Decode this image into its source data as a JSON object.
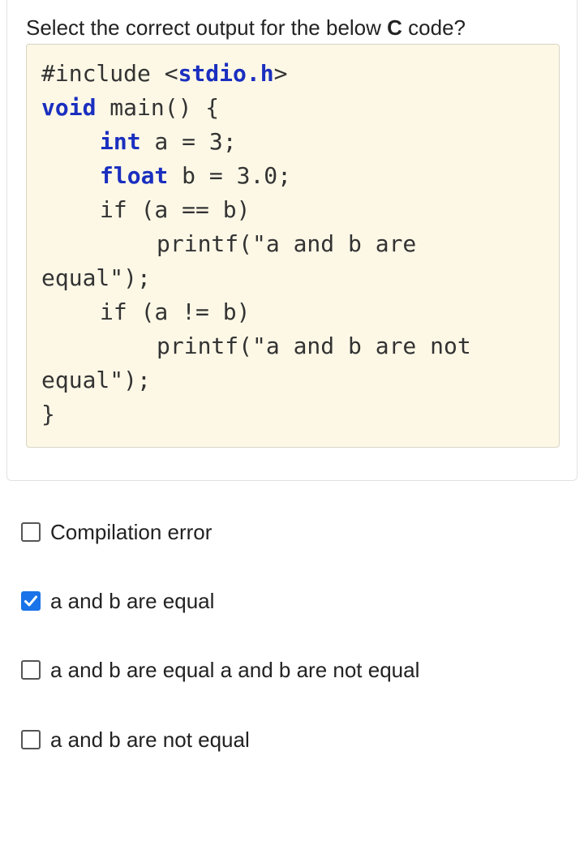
{
  "question": {
    "prefix": "Select the correct output for the below ",
    "language": "C",
    "suffix": " code?"
  },
  "code": {
    "l1_a": "#include <",
    "l1_b": "stdio.h",
    "l1_c": ">",
    "l2_kw": "void",
    "l2_rest": " main() {",
    "l3_kw": "int",
    "l3_rest": " a = 3;",
    "l4_kw": "float",
    "l4_rest": " b = 3.0;",
    "l5": "if (a == b)",
    "l6": "printf(\"a and b are",
    "l7": "equal\");",
    "l8": "if (a != b)",
    "l9": "printf(\"a and b are not",
    "l10": "equal\");",
    "l11": "}"
  },
  "options": [
    {
      "label": "Compilation error",
      "checked": false
    },
    {
      "label": "a and b are equal",
      "checked": true
    },
    {
      "label": "a and b are equal a and b are not equal",
      "checked": false
    },
    {
      "label": "a and b are not equal",
      "checked": false
    }
  ],
  "colors": {
    "keyword": "#1a2fbf",
    "code_background": "#fdf8e6",
    "checkbox_checked": "#1a73e8"
  },
  "icons": {
    "checked": "checkmark-icon"
  }
}
